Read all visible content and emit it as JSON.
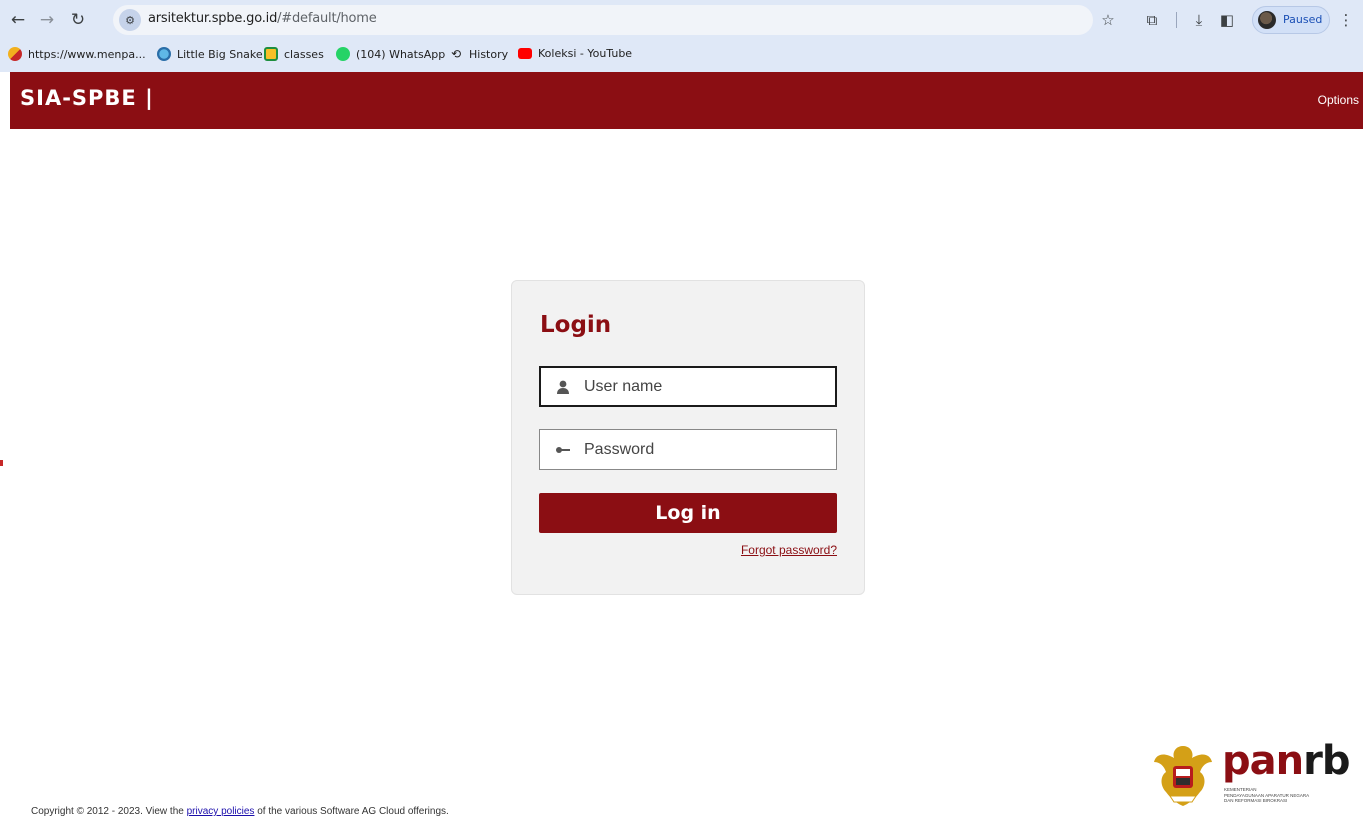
{
  "browser": {
    "url_host": "arsitektur.spbe.go.id",
    "url_path": "/#default/home",
    "profile_status": "Paused",
    "bookmarks": [
      {
        "label": "https://www.menpa...",
        "icon": "menpan-favicon-icon"
      },
      {
        "label": "Little Big Snake",
        "icon": "snake-favicon-icon"
      },
      {
        "label": "classes",
        "icon": "classroom-favicon-icon"
      },
      {
        "label": "(104) WhatsApp",
        "icon": "whatsapp-favicon-icon"
      },
      {
        "label": "History",
        "icon": "history-icon"
      },
      {
        "label": "Koleksi - YouTube",
        "icon": "youtube-favicon-icon"
      }
    ]
  },
  "header": {
    "brand": "SIA-SPBE |",
    "options_label": "Options",
    "background": "#8b0e13"
  },
  "login": {
    "title": "Login",
    "username_placeholder": "User name",
    "password_placeholder": "Password",
    "submit_label": "Log in",
    "forgot_label": "Forgot password?"
  },
  "footer": {
    "prefix": "Copyright © 2012 - 2023. View the ",
    "link": "privacy policies",
    "suffix": " of the various Software AG Cloud offerings."
  },
  "logo": {
    "word_pan": "pan",
    "word_rb": "rb",
    "subtitle_line1": "KEMENTERIAN",
    "subtitle_line2": "PENDAYAGUNAAN APARATUR NEGARA",
    "subtitle_line3": "DAN REFORMASI BIROKRASI"
  }
}
